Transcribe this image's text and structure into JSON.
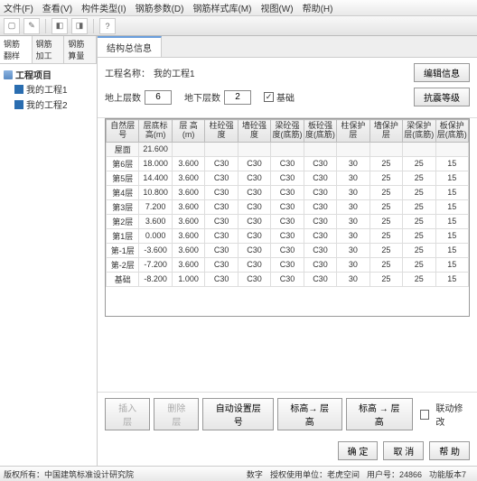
{
  "menu": {
    "file": "文件(F)",
    "view": "查看(V)",
    "component": "构件类型(I)",
    "param": "钢筋参数(D)",
    "style": "钢筋样式库(M)",
    "viewm": "视图(W)",
    "help": "帮助(H)"
  },
  "left_tabs": {
    "t1": "钢筋翻样",
    "t2": "钢筋加工",
    "t3": "钢筋算量"
  },
  "tree": {
    "root": "工程项目",
    "p1": "我的工程1",
    "p2": "我的工程2"
  },
  "right_tab": "结构总信息",
  "form": {
    "name_lbl": "工程名称：",
    "name_val": "我的工程1",
    "edit": "编辑信息",
    "above_lbl": "地上层数",
    "above_val": "6",
    "below_lbl": "地下层数",
    "below_val": "2",
    "base_lbl": "基础",
    "seismic": "抗震等级"
  },
  "cols": [
    "自然层号",
    "层底标高(m)",
    "层 高(m)",
    "柱砼强度",
    "墙砼强度",
    "梁砼强度(底筋)",
    "板砼强度(底筋)",
    "柱保护层",
    "墙保护层",
    "梁保护层(底筋)",
    "板保护层(底筋)"
  ],
  "rows": [
    {
      "n": "屋面",
      "b": "21.600",
      "h": "",
      "c1": "",
      "c2": "",
      "c3": "",
      "c4": "",
      "p1": "",
      "p2": "",
      "p3": "",
      "p4": ""
    },
    {
      "n": "第6层",
      "b": "18.000",
      "h": "3.600",
      "c1": "C30",
      "c2": "C30",
      "c3": "C30",
      "c4": "C30",
      "p1": "30",
      "p2": "25",
      "p3": "25",
      "p4": "15"
    },
    {
      "n": "第5层",
      "b": "14.400",
      "h": "3.600",
      "c1": "C30",
      "c2": "C30",
      "c3": "C30",
      "c4": "C30",
      "p1": "30",
      "p2": "25",
      "p3": "25",
      "p4": "15"
    },
    {
      "n": "第4层",
      "b": "10.800",
      "h": "3.600",
      "c1": "C30",
      "c2": "C30",
      "c3": "C30",
      "c4": "C30",
      "p1": "30",
      "p2": "25",
      "p3": "25",
      "p4": "15"
    },
    {
      "n": "第3层",
      "b": "7.200",
      "h": "3.600",
      "c1": "C30",
      "c2": "C30",
      "c3": "C30",
      "c4": "C30",
      "p1": "30",
      "p2": "25",
      "p3": "25",
      "p4": "15"
    },
    {
      "n": "第2层",
      "b": "3.600",
      "h": "3.600",
      "c1": "C30",
      "c2": "C30",
      "c3": "C30",
      "c4": "C30",
      "p1": "30",
      "p2": "25",
      "p3": "25",
      "p4": "15"
    },
    {
      "n": "第1层",
      "b": "0.000",
      "h": "3.600",
      "c1": "C30",
      "c2": "C30",
      "c3": "C30",
      "c4": "C30",
      "p1": "30",
      "p2": "25",
      "p3": "25",
      "p4": "15"
    },
    {
      "n": "第-1层",
      "b": "-3.600",
      "h": "3.600",
      "c1": "C30",
      "c2": "C30",
      "c3": "C30",
      "c4": "C30",
      "p1": "30",
      "p2": "25",
      "p3": "25",
      "p4": "15"
    },
    {
      "n": "第-2层",
      "b": "-7.200",
      "h": "3.600",
      "c1": "C30",
      "c2": "C30",
      "c3": "C30",
      "c4": "C30",
      "p1": "30",
      "p2": "25",
      "p3": "25",
      "p4": "15"
    },
    {
      "n": "基础",
      "b": "-8.200",
      "h": "1.000",
      "c1": "C30",
      "c2": "C30",
      "c3": "C30",
      "c4": "C30",
      "p1": "30",
      "p2": "25",
      "p3": "25",
      "p4": "15"
    }
  ],
  "actions": {
    "insert": "插入层",
    "delete": "删除层",
    "auto": "自动设置层号",
    "bz": "标高→ 层高",
    "cz": "标高 → 层高",
    "linked": "联动修改",
    "ok": "确 定",
    "cancel": "取 消",
    "help": "帮 助"
  },
  "status": {
    "copyright": "版权所有：中国建筑标准设计研究院",
    "num": "数字",
    "auth": "授权使用单位：老虎空间",
    "user": "用户号：24866",
    "ver": "功能版本7"
  }
}
